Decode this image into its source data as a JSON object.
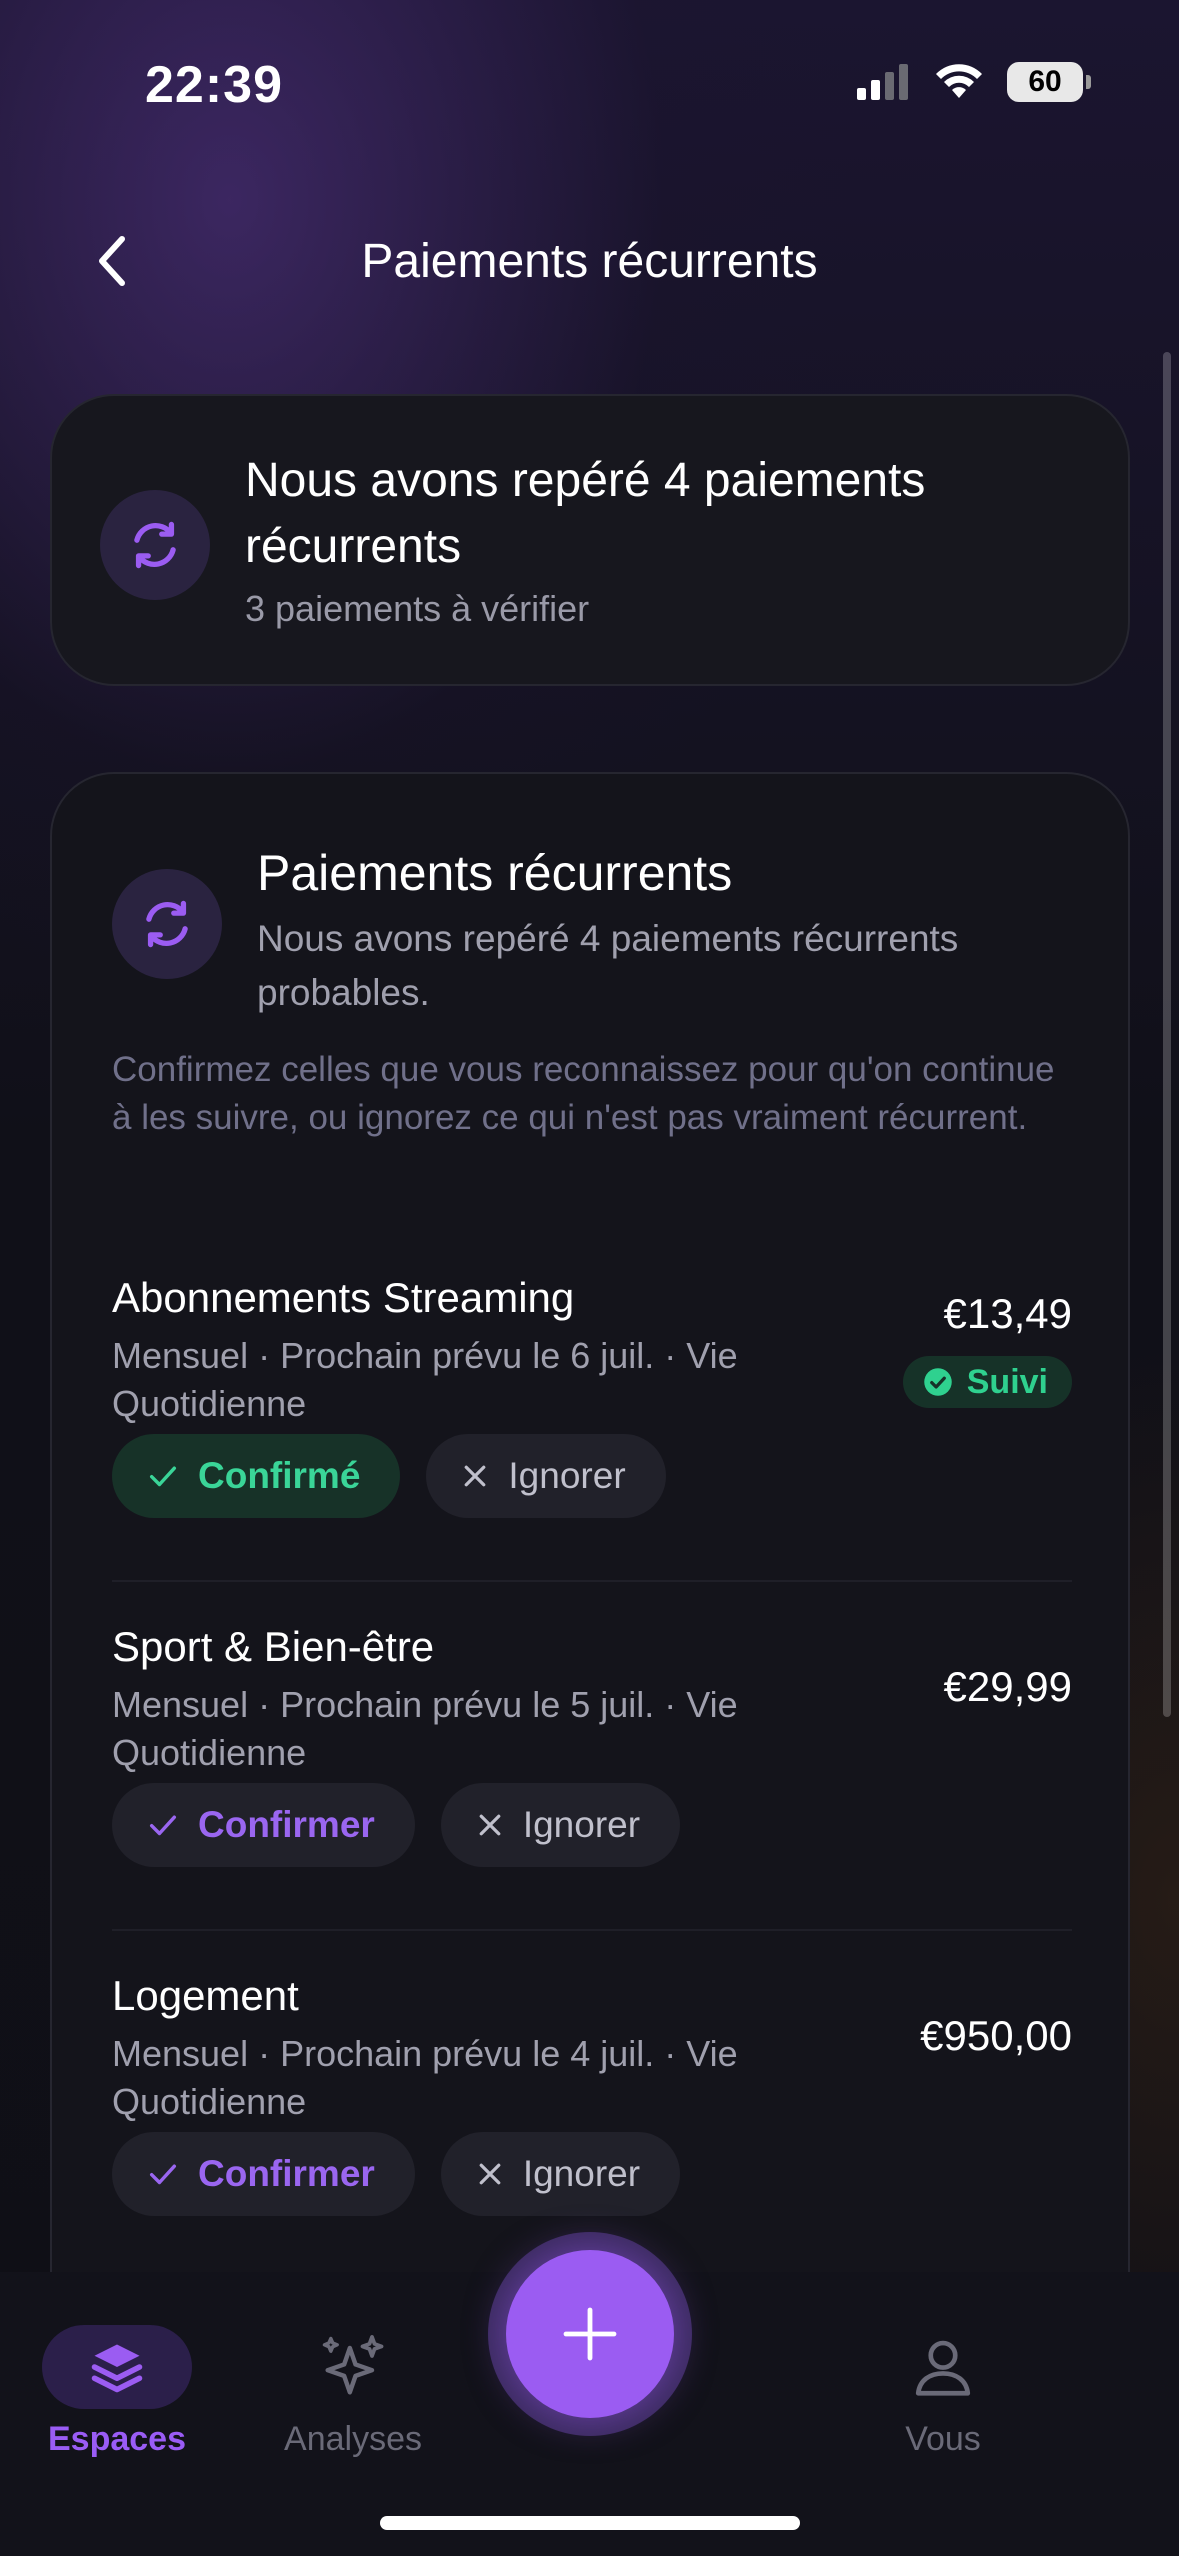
{
  "status_bar": {
    "time": "22:39",
    "battery": "60"
  },
  "header": {
    "title": "Paiements récurrents",
    "back_icon": "chevron-left-icon"
  },
  "summary": {
    "title": "Nous avons repéré 4 paiements récurrents",
    "subtitle": "3 paiements à vérifier",
    "icon": "refresh-icon"
  },
  "main": {
    "title": "Paiements récurrents",
    "subtitle": "Nous avons repéré 4 paiements récurrents probables.",
    "note": "Confirmez celles que vous reconnaissez pour qu'on continue à les suivre, ou ignorez ce qui n'est pas vraiment récurrent.",
    "items": [
      {
        "name": "Abonnements Streaming",
        "meta": "Mensuel · Prochain prévu le 6 juil. · Vie Quotidienne",
        "amount": "€13,49",
        "badge": "Suivi",
        "primary_label": "Confirmé",
        "ignore_label": "Ignorer"
      },
      {
        "name": "Sport & Bien-être",
        "meta": "Mensuel · Prochain prévu le 5 juil. · Vie Quotidienne",
        "amount": "€29,99",
        "primary_label": "Confirmer",
        "ignore_label": "Ignorer"
      },
      {
        "name": "Logement",
        "meta": "Mensuel · Prochain prévu le 4 juil. · Vie Quotidienne",
        "amount": "€950,00",
        "primary_label": "Confirmer",
        "ignore_label": "Ignorer"
      }
    ]
  },
  "nav": {
    "items": [
      {
        "label": "Espaces",
        "icon": "layers-icon",
        "active": true
      },
      {
        "label": "Analyses",
        "icon": "sparkles-icon",
        "active": false
      },
      {
        "label": "Vous",
        "icon": "person-icon",
        "active": false
      }
    ],
    "fab_icon": "plus-icon"
  },
  "colors": {
    "accent": "#9b5cf2",
    "success": "#2fd18f",
    "background": "#0f0f16"
  }
}
